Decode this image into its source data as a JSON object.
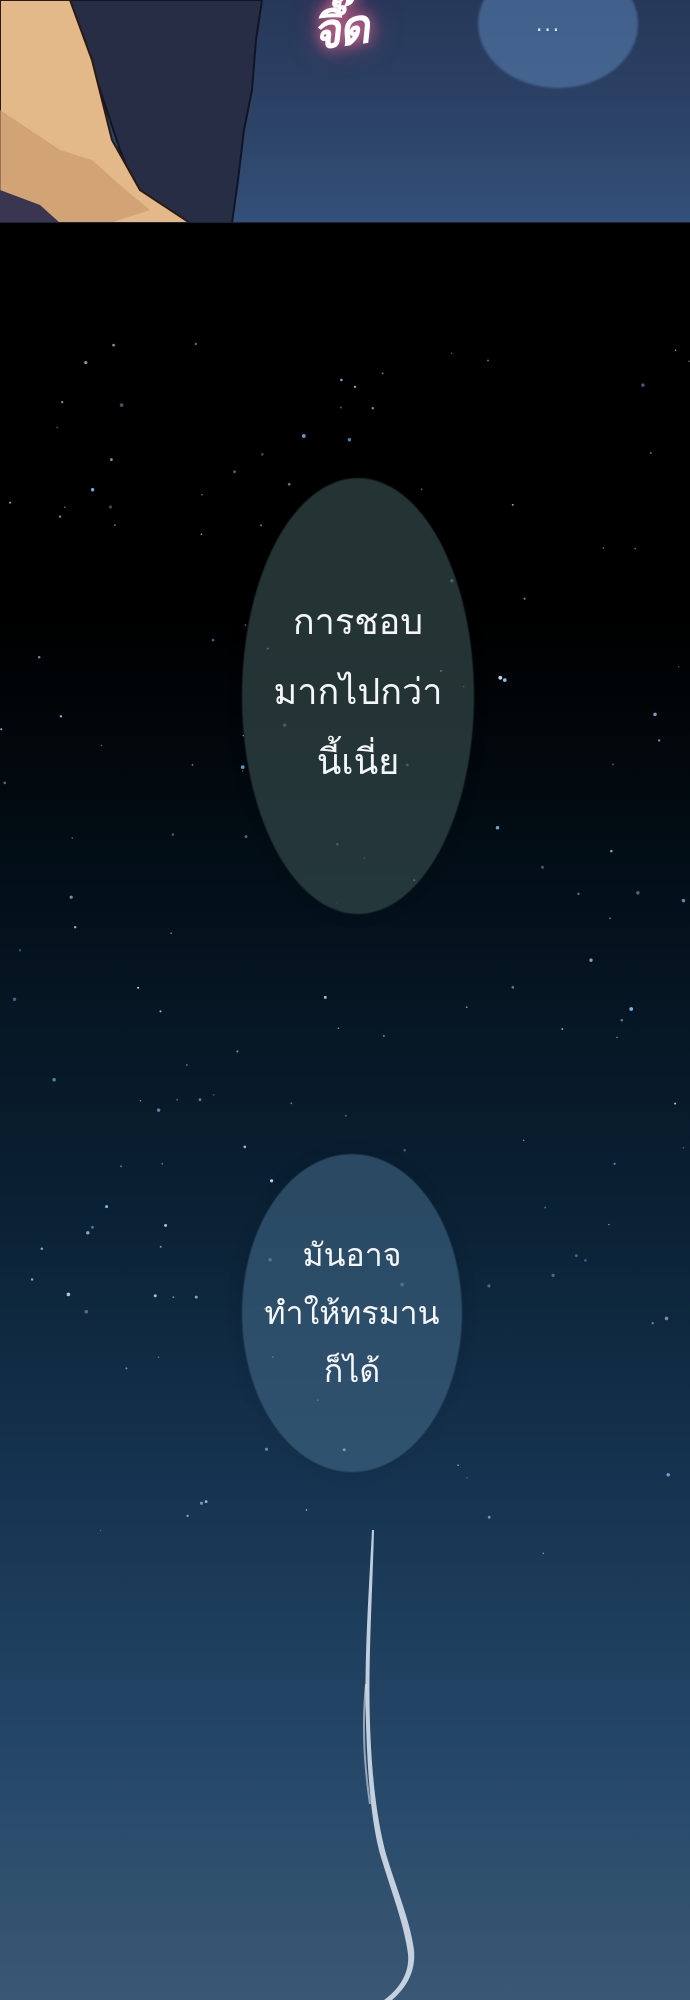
{
  "top_panel": {
    "sfx": "จึ๊ด",
    "ellipsis": "..."
  },
  "speech_bubbles": [
    {
      "lines": [
        "การชอบ",
        "มากไปกว่า",
        "นี้เนี่ย"
      ]
    },
    {
      "lines": [
        "มันอาจ",
        "ทำให้ทรมาน",
        "ก็ได้"
      ]
    }
  ],
  "colors": {
    "sky_top": "#000000",
    "sky_bottom": "#3a5874",
    "skin": "#e3b98a",
    "shirt": "#272d44",
    "sfx_glow": "#ff5a8a"
  }
}
